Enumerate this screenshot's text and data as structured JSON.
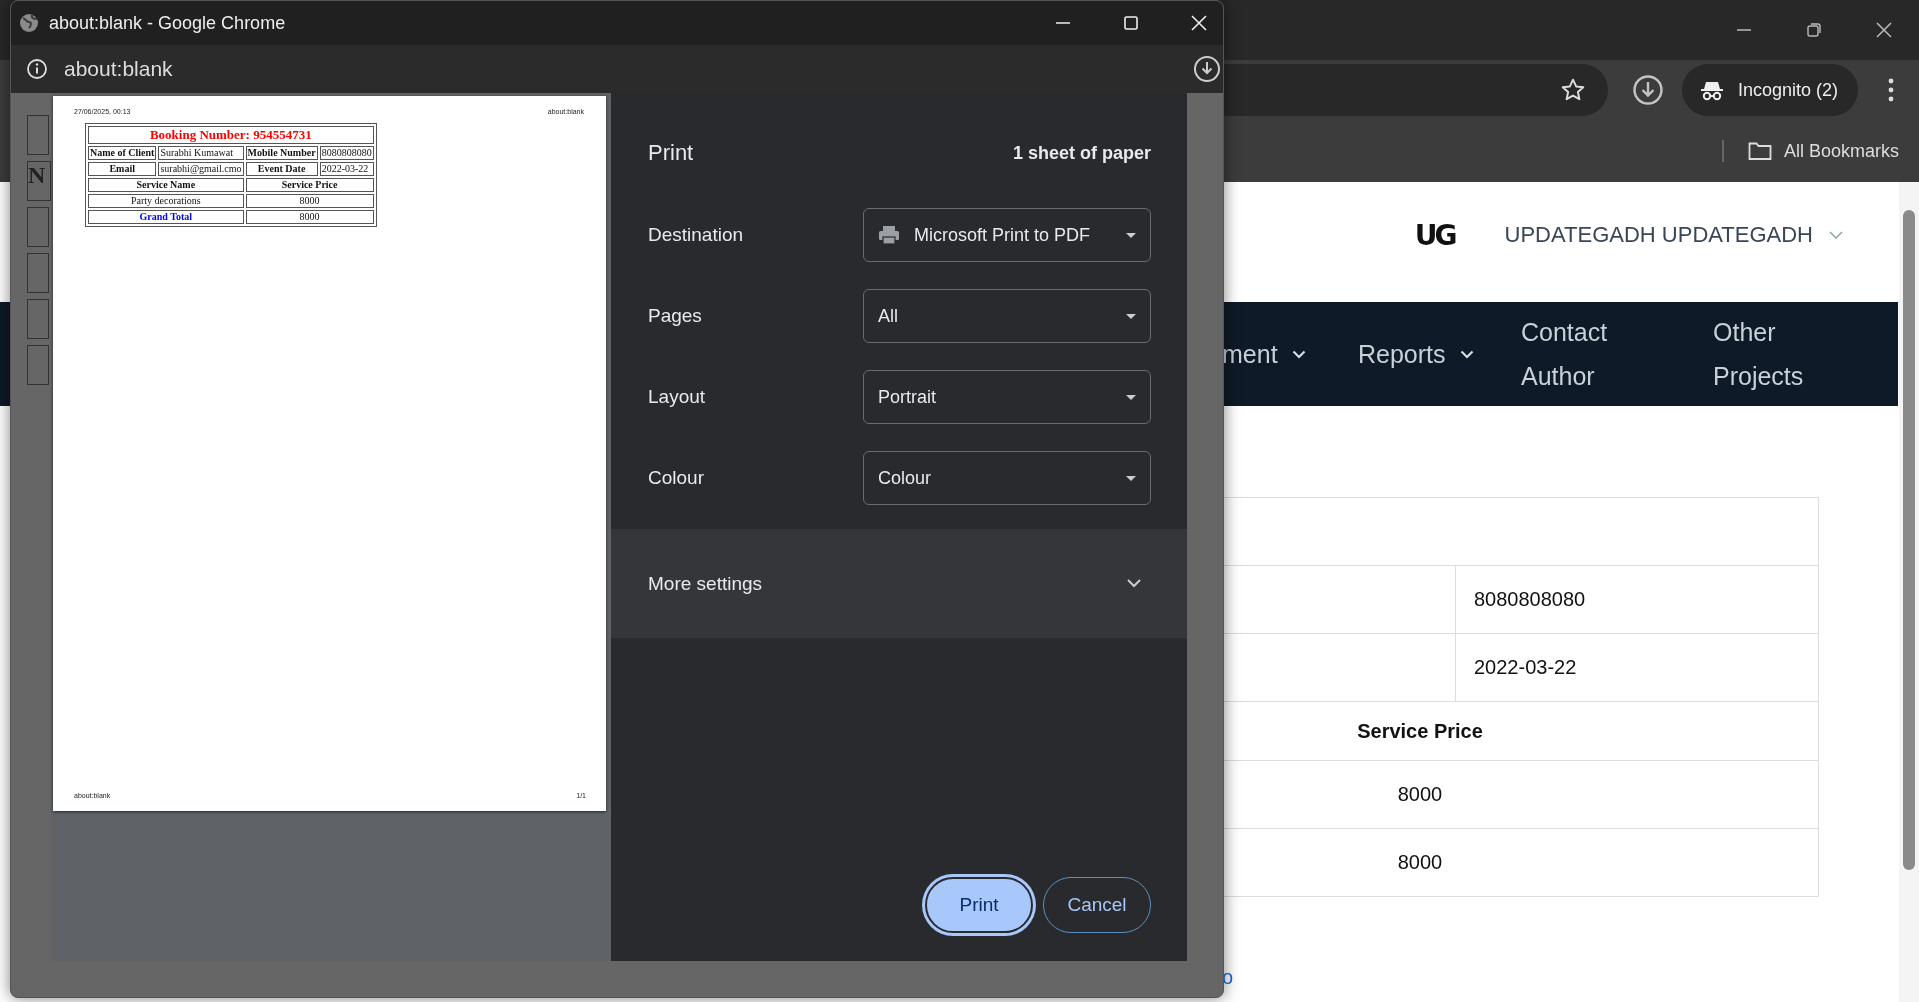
{
  "browser": {
    "incognito_label": "Incognito (2)",
    "bookmarks": [
      "All Bookmarks"
    ]
  },
  "page": {
    "logo": "UG",
    "user_name": "UPDATEGADH UPDATEGADH",
    "nav": [
      {
        "label": "ment",
        "has_menu": true
      },
      {
        "label": "Reports",
        "has_menu": true
      },
      {
        "label": "Contact Author",
        "has_menu": false
      },
      {
        "label": "Other Projects",
        "has_menu": false
      }
    ],
    "table_rows": [
      {
        "kind": "blank",
        "text": ""
      },
      {
        "kind": "split",
        "text": "8080808080"
      },
      {
        "kind": "split",
        "text": "2022-03-22"
      },
      {
        "kind": "heading",
        "text": "Service Price"
      },
      {
        "kind": "amount",
        "text": "8000"
      },
      {
        "kind": "amount",
        "text": "8000"
      }
    ],
    "link_fragment": "o"
  },
  "popup": {
    "title": "about:blank - Google Chrome",
    "address": "about:blank",
    "side_fragment": "N",
    "preview": {
      "header_left": "27/06/2025, 00:13",
      "header_right": "about:blank",
      "booking_title": "Booking Number: 954554731",
      "details": [
        [
          "Name of Client",
          "Surabhi Kumawat",
          "Mobile Number",
          "8080808080"
        ],
        [
          "Email",
          "surabhi@gmail.cmo",
          "Event Date",
          "2022-03-22"
        ]
      ],
      "service_columns": [
        "Service Name",
        "Service Price"
      ],
      "services": [
        [
          "Party decorations",
          "8000"
        ]
      ],
      "total": [
        "Grand Total",
        "8000"
      ],
      "footer_left": "about:blank",
      "footer_right": "1/1"
    },
    "print": {
      "title": "Print",
      "sheets": "1 sheet of paper",
      "settings": [
        {
          "label": "Destination",
          "value": "Microsoft Print to PDF",
          "kind": "printer"
        },
        {
          "label": "Pages",
          "value": "All",
          "kind": "plain"
        },
        {
          "label": "Layout",
          "value": "Portrait",
          "kind": "plain"
        },
        {
          "label": "Colour",
          "value": "Colour",
          "kind": "plain"
        }
      ],
      "more_settings": {
        "label": "More settings",
        "expanded": false
      },
      "buttons": [
        {
          "label": "Print",
          "kind": "primary"
        },
        {
          "label": "Cancel",
          "kind": "secondary"
        }
      ]
    }
  }
}
